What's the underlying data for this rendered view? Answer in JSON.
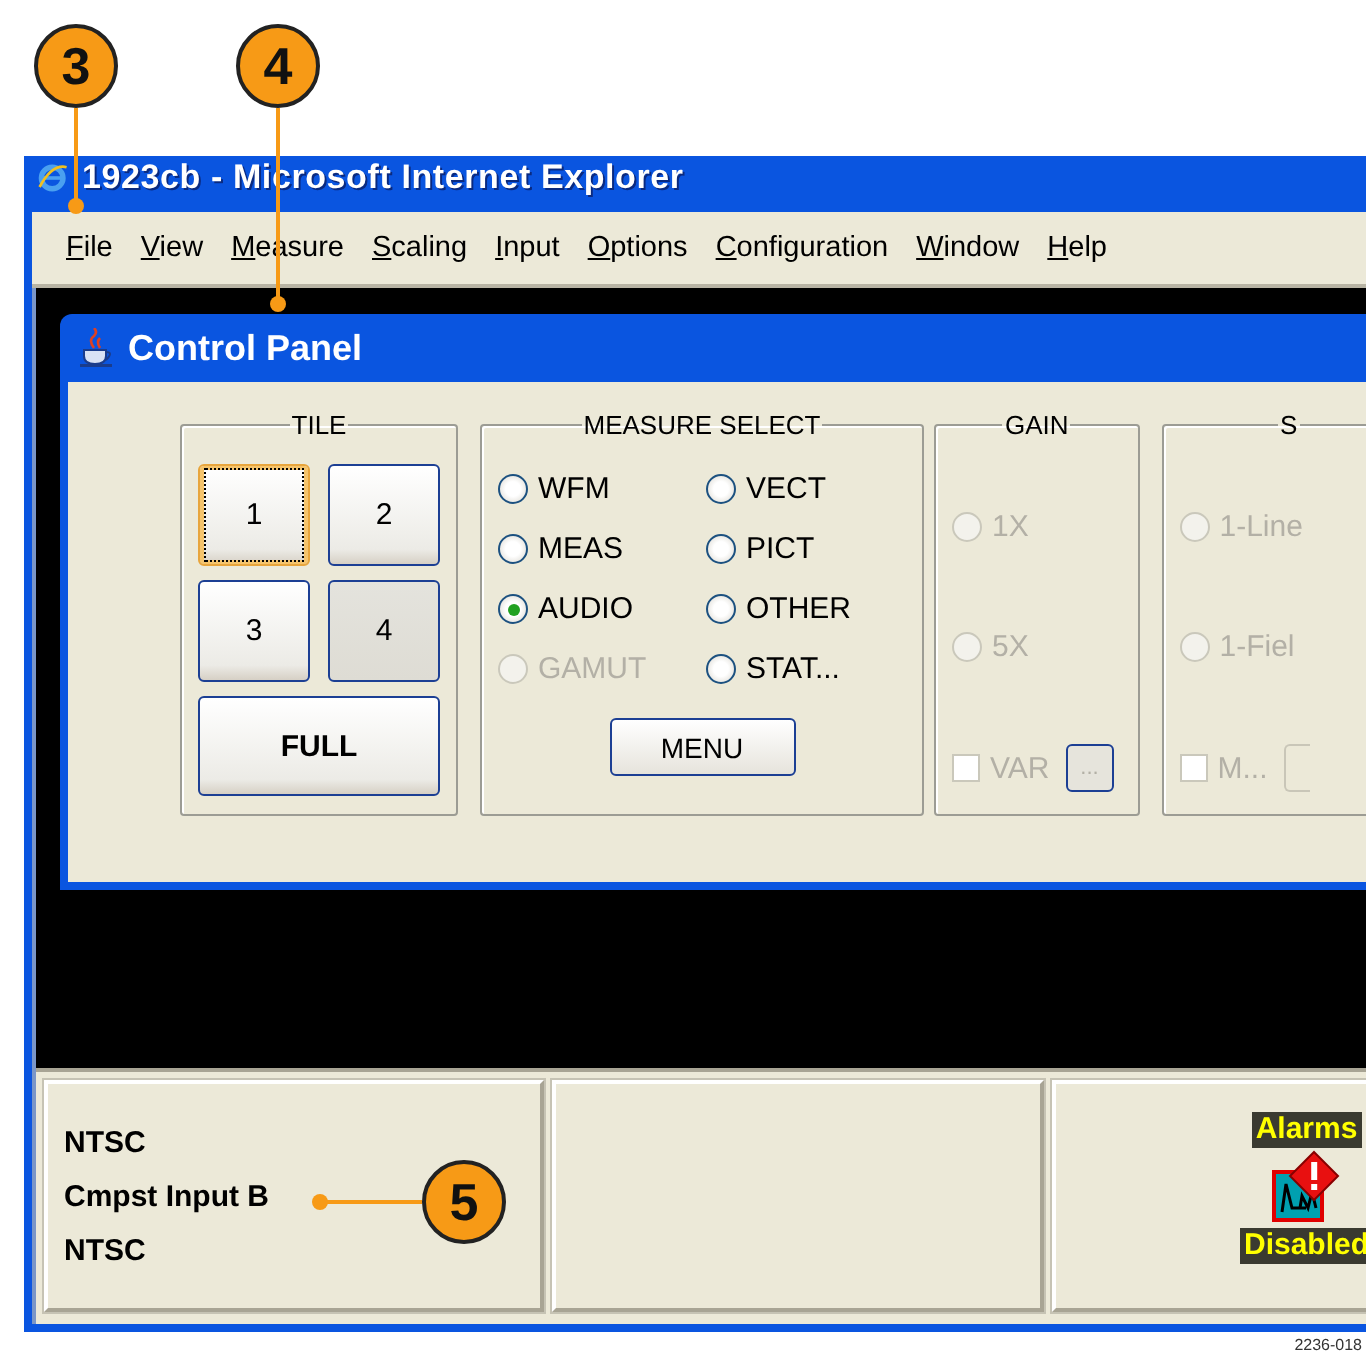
{
  "callouts": [
    {
      "label": "3"
    },
    {
      "label": "4"
    },
    {
      "label": "5"
    }
  ],
  "browser": {
    "title": "1923cb - Microsoft Internet Explorer",
    "menu": [
      "File",
      "View",
      "Measure",
      "Scaling",
      "Input",
      "Options",
      "Configuration",
      "Window",
      "Help"
    ]
  },
  "control_panel": {
    "title": "Control Panel",
    "tile": {
      "title": "TILE",
      "buttons": [
        {
          "label": "1",
          "focused": true,
          "selected": false
        },
        {
          "label": "2",
          "focused": false,
          "selected": false
        },
        {
          "label": "3",
          "focused": false,
          "selected": false
        },
        {
          "label": "4",
          "focused": false,
          "selected": true
        }
      ],
      "full_button": "FULL"
    },
    "measure_select": {
      "title": "MEASURE SELECT",
      "options": [
        {
          "label": "WFM",
          "selected": false,
          "disabled": false
        },
        {
          "label": "VECT",
          "selected": false,
          "disabled": false
        },
        {
          "label": "MEAS",
          "selected": false,
          "disabled": false
        },
        {
          "label": "PICT",
          "selected": false,
          "disabled": false
        },
        {
          "label": "AUDIO",
          "selected": true,
          "disabled": false
        },
        {
          "label": "OTHER",
          "selected": false,
          "disabled": false
        },
        {
          "label": "GAMUT",
          "selected": false,
          "disabled": true
        },
        {
          "label": "STAT...",
          "selected": false,
          "disabled": false
        }
      ],
      "menu_button": "MENU"
    },
    "gain": {
      "title": "GAIN",
      "options": [
        {
          "label": "1X",
          "selected": false,
          "disabled": true
        },
        {
          "label": "5X",
          "selected": false,
          "disabled": true
        }
      ],
      "checkbox": {
        "label": "VAR",
        "checked": false,
        "disabled": true
      },
      "button": "..."
    },
    "group_4": {
      "title": "S",
      "options": [
        {
          "label": "1-Line",
          "selected": false,
          "disabled": true
        },
        {
          "label": "1-Fiel",
          "selected": false,
          "disabled": true
        }
      ],
      "checkbox": {
        "label": "M...",
        "checked": false,
        "disabled": true
      }
    }
  },
  "status_bar": {
    "input_lines": [
      "NTSC",
      "Cmpst Input B",
      "NTSC"
    ],
    "alarms": {
      "top": "Alarms",
      "bottom": "Disabled"
    }
  },
  "figure_id": "2236-018"
}
